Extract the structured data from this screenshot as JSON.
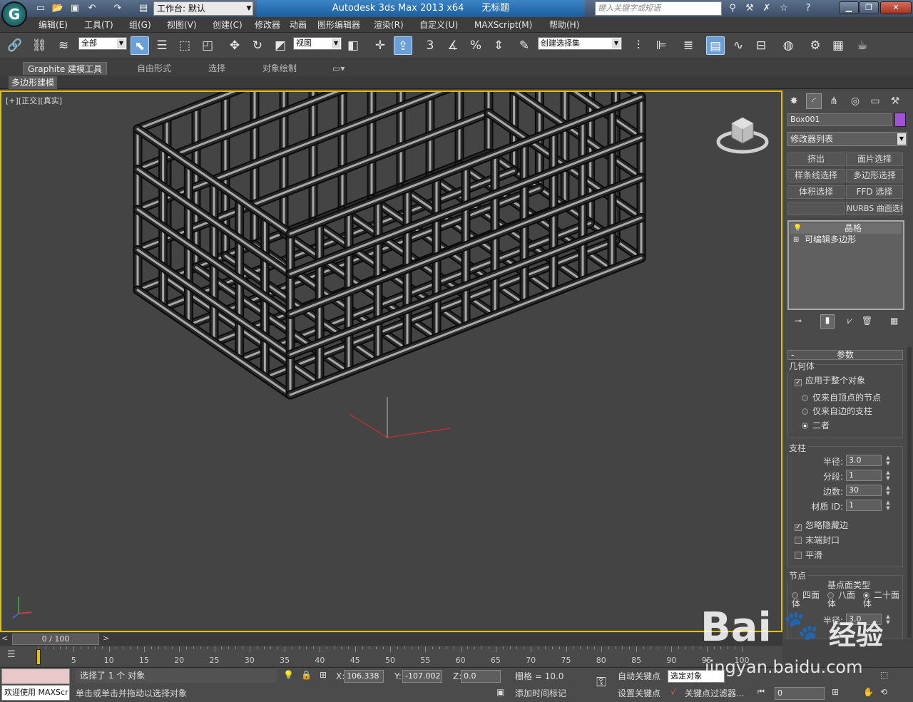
{
  "titlebar": {
    "workspace": "工作台: 默认",
    "app_title": "Autodesk 3ds Max  2013 x64",
    "doc_title": "无标题",
    "search_placeholder": "键入关键字或短语",
    "logo_icon": "3dsmax-logo-icon"
  },
  "menu": [
    "编辑(E)",
    "工具(T)",
    "组(G)",
    "视图(V)",
    "创建(C)",
    "修改器",
    "动画",
    "图形编辑器",
    "渲染(R)",
    "自定义(U)",
    "MAXScript(M)",
    "帮助(H)"
  ],
  "toolbar": {
    "selection_filter": "全部",
    "ref_coord": "视图",
    "named_selection": "创建选择集",
    "snap_3": "3",
    "angle_snap_label": "%"
  },
  "ribbon": {
    "tabs": [
      "Graphite 建模工具",
      "自由形式",
      "选择",
      "对象绘制"
    ],
    "active_tab": "Graphite 建模工具",
    "sub_label": "多边形建模"
  },
  "viewport": {
    "label_plus": "[+]",
    "label_view": "[正交]",
    "label_shading": "[真实]"
  },
  "command_panel": {
    "object_name": "Box001",
    "object_color": "#9d52d8",
    "modifier_list": "修改器列表",
    "mod_buttons": [
      "挤出",
      "面片选择",
      "样条线选择",
      "多边形选择",
      "体积选择",
      "FFD 选择",
      "",
      "NURBS 曲面选择"
    ],
    "stack": [
      {
        "label": "晶格",
        "icon": "lightbulb-icon"
      },
      {
        "label": "可编辑多边形",
        "icon": "plus-expand-icon"
      }
    ],
    "params_title": "参数",
    "geometry": {
      "title": "几何体",
      "apply_whole": "应用于整个对象",
      "apply_whole_checked": true,
      "options": [
        "仅来自顶点的节点",
        "仅来自边的支柱",
        "二者"
      ],
      "selected_option": 2
    },
    "struts": {
      "title": "支柱",
      "radius_label": "半径:",
      "radius": "3.0",
      "segments_label": "分段:",
      "segments": "1",
      "sides_label": "边数:",
      "sides": "30",
      "matid_label": "材质 ID:",
      "matid": "1",
      "ignore_hidden": "忽略隐藏边",
      "ignore_hidden_checked": true,
      "end_caps": "末端封口",
      "end_caps_checked": false,
      "smooth": "平滑",
      "smooth_checked": false
    },
    "joints": {
      "title": "节点",
      "base_type_label": "基点面类型",
      "types": [
        "四面体",
        "八面体",
        "二十面体"
      ],
      "selected_type": 2,
      "radius_label": "半径:",
      "radius": "3.0"
    }
  },
  "timeline": {
    "frame_display": "0 / 100",
    "ticks": [
      "0",
      "5",
      "10",
      "15",
      "20",
      "25",
      "30",
      "35",
      "40",
      "45",
      "50",
      "55",
      "60",
      "65",
      "70",
      "75",
      "80",
      "85",
      "90",
      "95",
      "100"
    ]
  },
  "status": {
    "selected": "选择了 1 个 对象",
    "prompt": "单击或单击并拖动以选择对象",
    "welcome": "欢迎使用 MAXScr",
    "x_label": "X:",
    "x": "106.338",
    "y_label": "Y:",
    "y": "-107.002",
    "z_label": "Z:",
    "z": "0.0",
    "grid": "栅格 = 10.0",
    "add_time_tag": "添加时间标记",
    "auto_key": "自动关键点",
    "set_key": "设置关键点",
    "key_mode": "选定对象",
    "key_filters": "关键点过滤器...",
    "frame": "0"
  },
  "watermark": {
    "brand": "Bai",
    "brand2": "经验",
    "url": "jingyan.baidu.com"
  }
}
